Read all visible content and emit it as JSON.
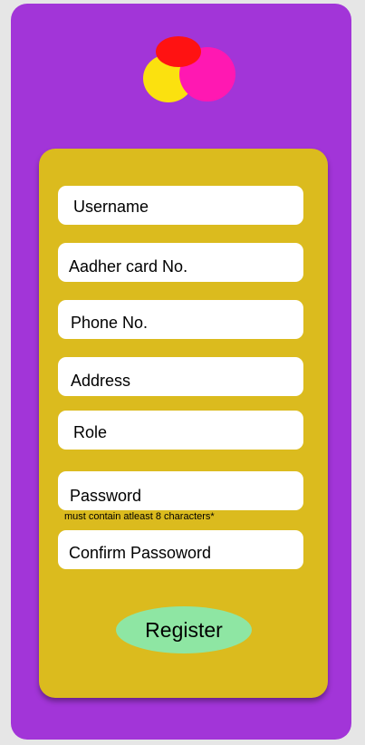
{
  "form": {
    "fields": [
      {
        "label": "Username"
      },
      {
        "label": "Aadher card No."
      },
      {
        "label": "Phone No."
      },
      {
        "label": "Address"
      },
      {
        "label": "Role"
      },
      {
        "label": "Password"
      },
      {
        "label": "Confirm Passoword"
      }
    ],
    "password_hint": "must contain atleast 8 characters*",
    "register_label": "Register"
  },
  "colors": {
    "background": "#a235d8",
    "card": "#dbbb1e",
    "button": "#8ee6a3",
    "logo_yellow": "#fbe10f",
    "logo_pink": "#ff18b2",
    "logo_red": "#ff1212"
  }
}
